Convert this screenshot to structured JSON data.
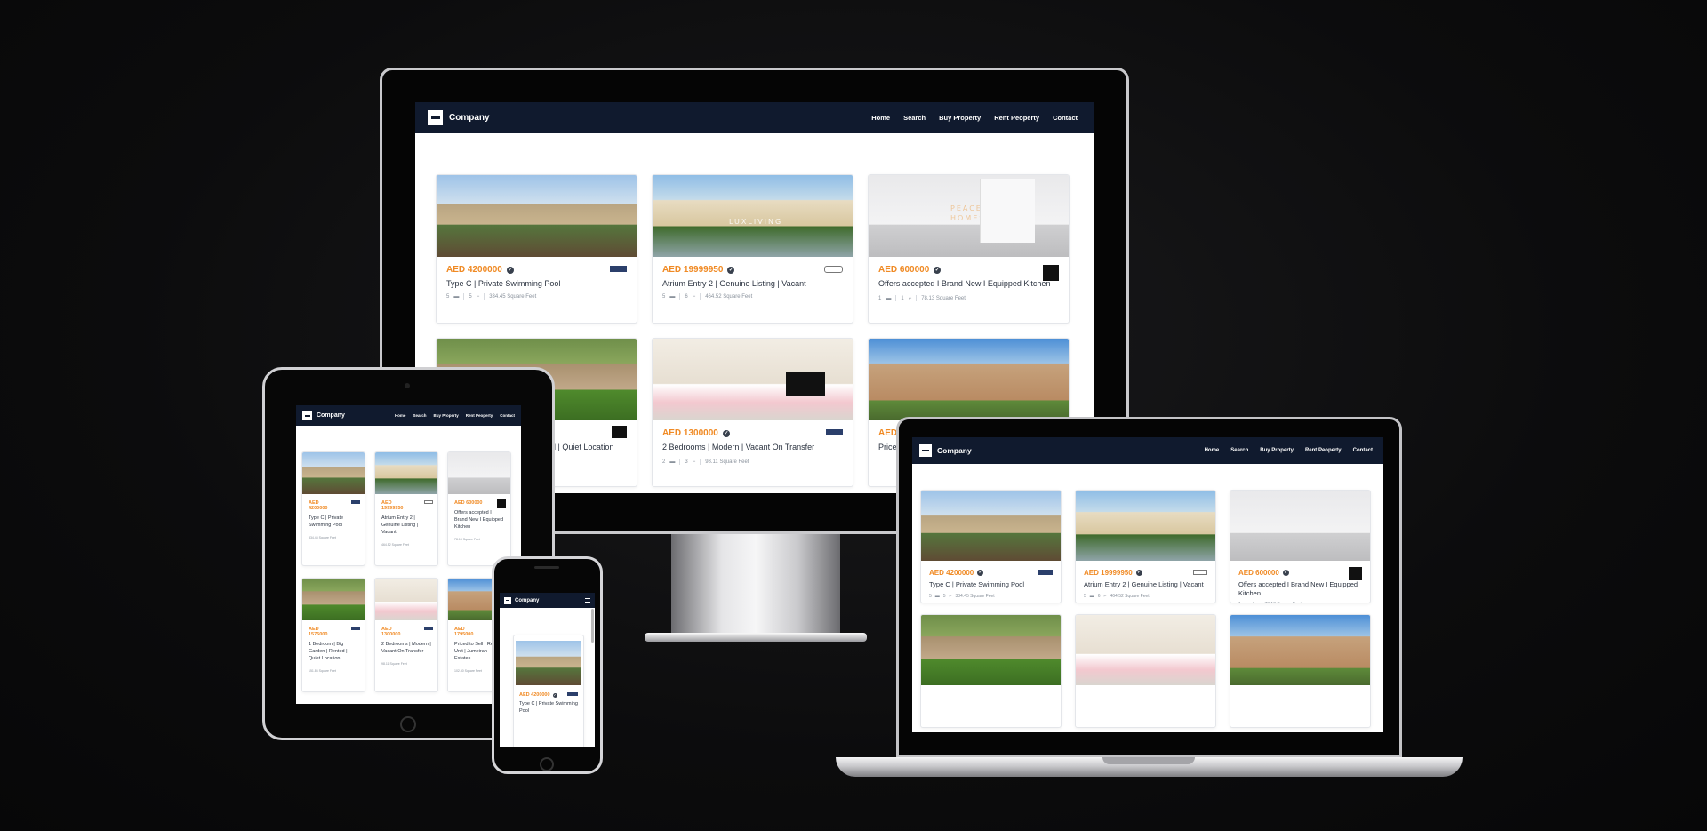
{
  "site": {
    "brand": "Company",
    "nav": [
      "Home",
      "Search",
      "Buy Property",
      "Rent Peoperty",
      "Contact"
    ]
  },
  "listings": [
    {
      "price": "AED 4200000",
      "title": "Type C | Private Swimming Pool",
      "beds": "5",
      "baths": "5",
      "area": "334.45 Square Feet",
      "photo": "villa-courtyard",
      "watermark": ""
    },
    {
      "price": "AED 19999950",
      "title": "Atrium Entry 2 | Genuine Listing | Vacant",
      "beds": "5",
      "baths": "6",
      "area": "464.52 Square Feet",
      "photo": "mansion-garden",
      "watermark": "LUXLIVING"
    },
    {
      "price": "AED 600000",
      "title": "Offers accepted I Brand New I Equipped Kitchen",
      "beds": "1",
      "baths": "1",
      "area": "78.13 Square Feet",
      "photo": "empty-room",
      "watermark": "PEACE HOMES"
    },
    {
      "price": "AED 1575000",
      "title": "1 Bedroom | Big Garden | Rented | Quiet Location",
      "beds": "1",
      "baths": "1",
      "area": "151.86 Square Feet",
      "photo": "garden-villa",
      "watermark": ""
    },
    {
      "price": "AED 1300000",
      "title": "2 Bedrooms | Modern | Vacant On Transfer",
      "beds": "2",
      "baths": "3",
      "area": "98.11 Square Feet",
      "photo": "living-room",
      "watermark": ""
    },
    {
      "price": "AED 1795000",
      "title": "Priced to Sell | Rented Unit | Jumeirah Estates",
      "beds": "1",
      "baths": "1",
      "area": "102.80 Square Feet",
      "photo": "tower-block",
      "watermark": ""
    }
  ],
  "monitor": {
    "row2_title_1_partial": "d | Quiet Location",
    "row2_price_3_partial": "AED",
    "row2_title_3_partial": "Price"
  },
  "icons": {
    "verified": "verified-check-icon",
    "bed": "bed-icon",
    "bath": "bath-icon",
    "logo": "company-logo-icon"
  },
  "colors": {
    "navbar": "#101a2e",
    "price": "#f08a24",
    "background": "#0c0c0d"
  }
}
